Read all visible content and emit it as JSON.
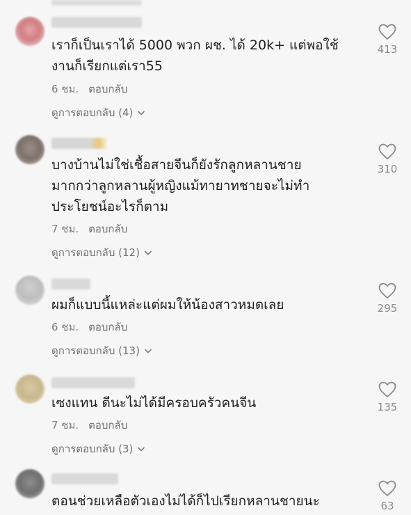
{
  "comments": [
    {
      "text": "เราก็เป็นเราได้ 5000 พวก ผช. ได้ 20k+ แต่พอใช้\nงานก็เรียกแต่เรา55",
      "time": "6 ชม.",
      "reply_label": "ตอบกลับ",
      "view_replies": "ดูการตอบกลับ (4)",
      "likes": "413"
    },
    {
      "text": "บางบ้านไม่ใช่เชื้อสายจีนก็ยังรักลูกหลานชาย\nมากกว่าลูกหลานผู้หญิงแม้ทายาทชายจะไม่ทำ\nประโยชน์อะไรก็ตาม",
      "time": "7 ชม.",
      "reply_label": "ตอบกลับ",
      "view_replies": "ดูการตอบกลับ (12)",
      "likes": "310"
    },
    {
      "text": "ผมก็แบบนี้แหล่ะแต่ผมให้น้องสาวหมดเลย",
      "time": "6 ชม.",
      "reply_label": "ตอบกลับ",
      "view_replies": "ดูการตอบกลับ (13)",
      "likes": "295"
    },
    {
      "text": "เซงแทน ดีนะไม่ได้มีครอบครัวคนจีน",
      "time": "7 ชม.",
      "reply_label": "ตอบกลับ",
      "view_replies": "ดูการตอบกลับ (3)",
      "likes": "135"
    },
    {
      "text": "ตอนช่วยเหลือตัวเองไม่ได้ก็ไปเรียกหลานชายนะ",
      "likes": "63"
    }
  ],
  "colors": {
    "text": "#1f1f1f",
    "meta": "#7c7c7c",
    "background": "#f6f6f6"
  }
}
